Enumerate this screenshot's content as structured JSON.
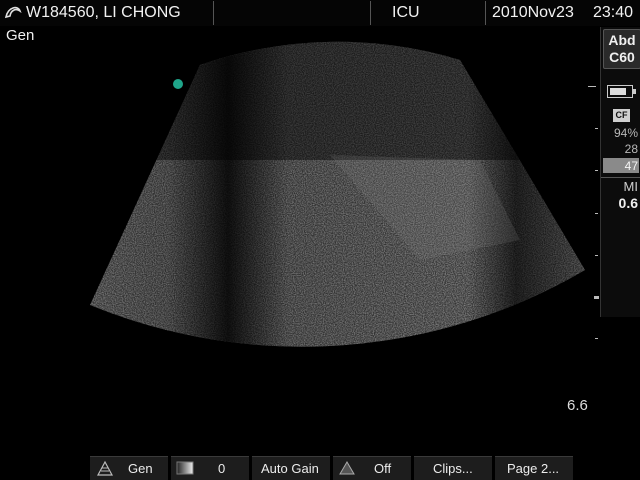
{
  "header": {
    "patient": "W184560, LI CHONG",
    "location": "ICU",
    "date": "2010Nov23",
    "time": "23:40"
  },
  "mode_label": "Gen",
  "depth_value": "6.6",
  "side_panel": {
    "probe_line1": "Abd",
    "probe_line2": "C60",
    "cf_label": "CF",
    "value1": "94%",
    "value2": "28",
    "value3": "47",
    "mi_label": "MI",
    "mi_value": "0.6",
    "battery_level": 0.8
  },
  "bottom_bar": {
    "exam_label": "Gen",
    "gain_value": "0",
    "auto_gain_label": "Auto Gain",
    "off_label": "Off",
    "clips_label": "Clips...",
    "page_label": "Page 2..."
  },
  "colors": {
    "focus_marker": "#1fa58a",
    "background": "#000000"
  },
  "icons": [
    "logo-icon",
    "battery-icon",
    "cf-icon",
    "probe-exam-icon",
    "gain-gradient-icon",
    "sector-icon"
  ]
}
